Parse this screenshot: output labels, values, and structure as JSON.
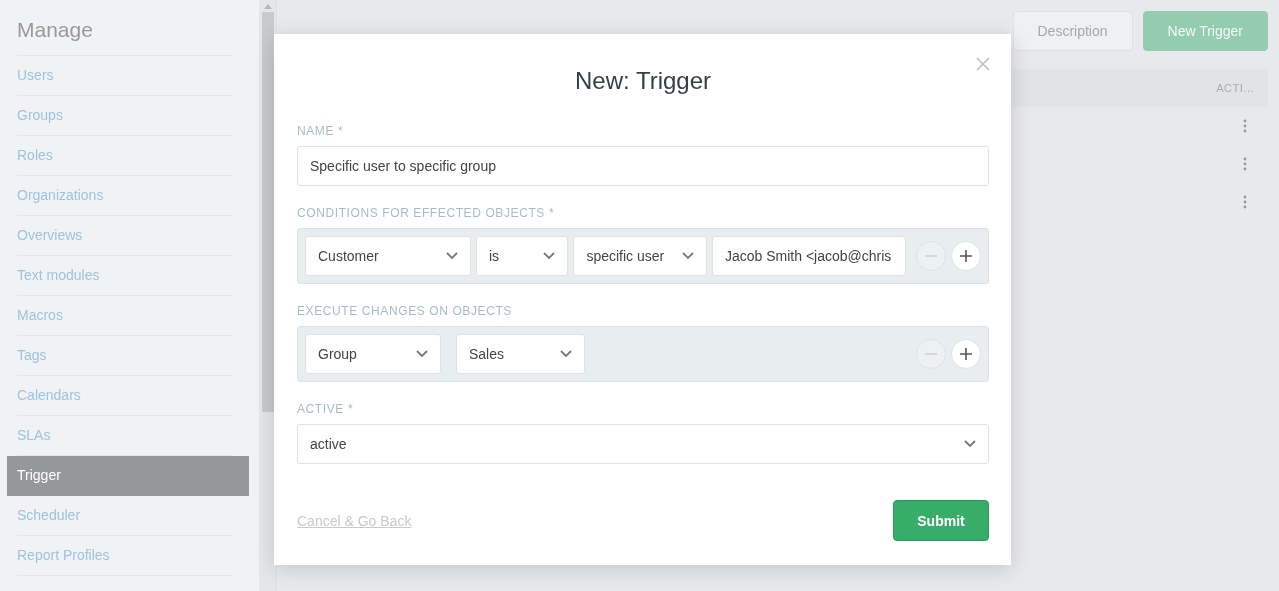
{
  "sidebar": {
    "title": "Manage",
    "items": [
      {
        "label": "Users",
        "selected": false
      },
      {
        "label": "Groups",
        "selected": false
      },
      {
        "label": "Roles",
        "selected": false
      },
      {
        "label": "Organizations",
        "selected": false
      },
      {
        "label": "Overviews",
        "selected": false
      },
      {
        "label": "Text modules",
        "selected": false
      },
      {
        "label": "Macros",
        "selected": false
      },
      {
        "label": "Tags",
        "selected": false
      },
      {
        "label": "Calendars",
        "selected": false
      },
      {
        "label": "SLAs",
        "selected": false
      },
      {
        "label": "Trigger",
        "selected": true
      },
      {
        "label": "Scheduler",
        "selected": false
      },
      {
        "label": "Report Profiles",
        "selected": false
      }
    ]
  },
  "page": {
    "buttons": [
      {
        "label": "Description",
        "kind": "secondary"
      },
      {
        "label": "New Trigger",
        "kind": "primary"
      }
    ],
    "table": {
      "columns": [
        "ACTI..."
      ],
      "rows": [
        {
          "kind": "menu"
        },
        {
          "kind": "menu"
        },
        {
          "kind": "menu"
        }
      ]
    }
  },
  "modal": {
    "title": "New: Trigger",
    "name": {
      "label": "NAME *",
      "value": "Specific user to specific group"
    },
    "conditions": {
      "label": "CONDITIONS FOR EFFECTED OBJECTS *",
      "items": [
        {
          "kind": "select",
          "value": "Customer"
        },
        {
          "kind": "select",
          "value": "is"
        },
        {
          "kind": "select",
          "value": "specific user"
        },
        {
          "kind": "input",
          "value": "Jacob Smith <jacob@chris"
        }
      ],
      "controls": [
        {
          "kind": "remove",
          "disabled": true
        },
        {
          "kind": "add",
          "disabled": false
        }
      ]
    },
    "changes": {
      "label": "EXECUTE CHANGES ON OBJECTS",
      "items": [
        {
          "kind": "select",
          "value": "Group"
        },
        {
          "kind": "select",
          "value": "Sales"
        }
      ],
      "controls": [
        {
          "kind": "remove",
          "disabled": true
        },
        {
          "kind": "add",
          "disabled": false
        }
      ]
    },
    "active": {
      "label": "ACTIVE *",
      "value": "active"
    },
    "cancel": "Cancel & Go Back",
    "submit": "Submit"
  }
}
